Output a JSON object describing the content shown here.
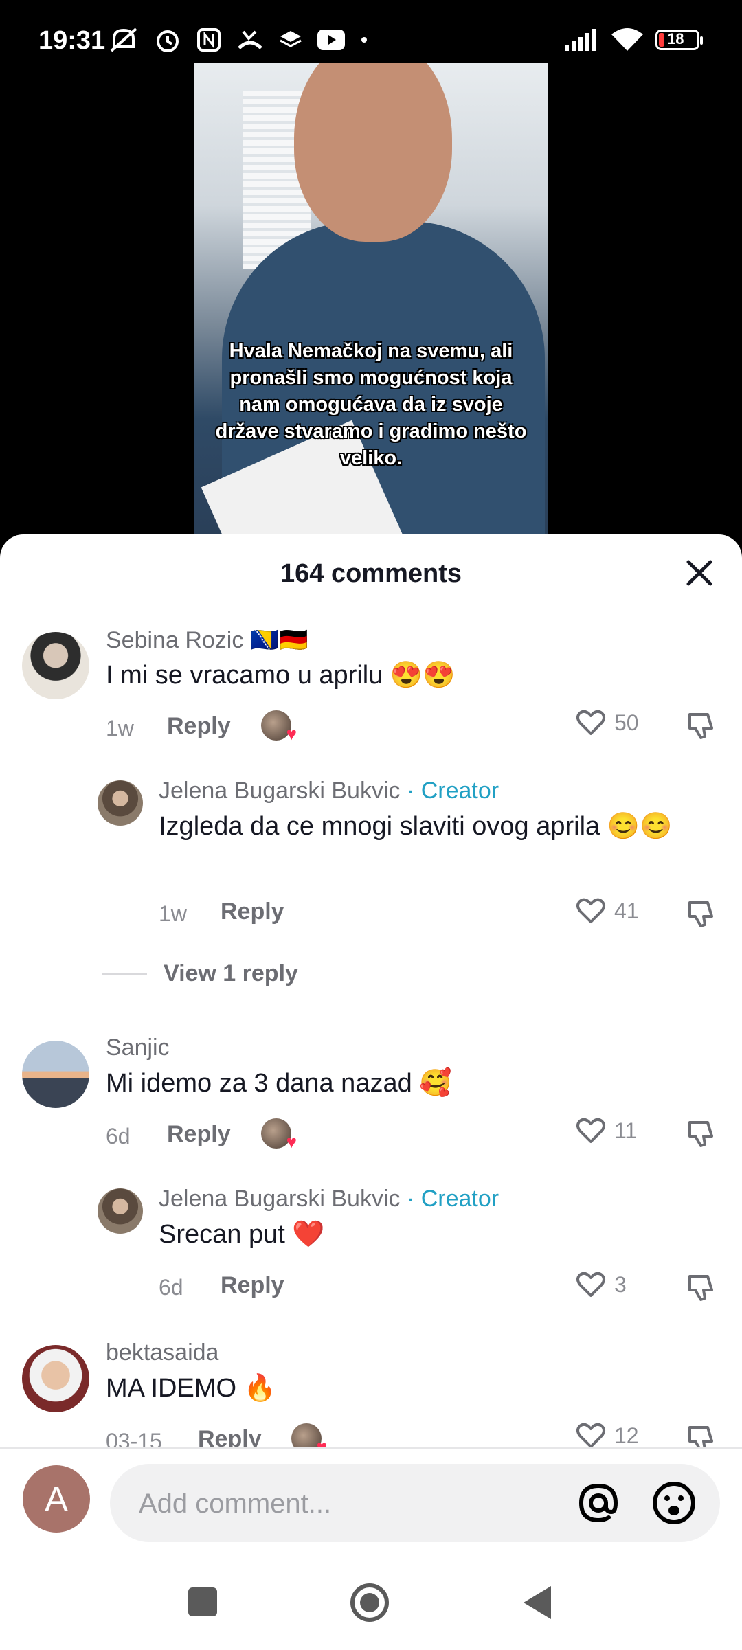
{
  "status_bar": {
    "time": "19:31",
    "battery": "18"
  },
  "video": {
    "caption": "Hvala Nemačkoj na svemu, ali pronašli smo mogućnost koja nam omogućava da iz svoje države stvaramo i gradimo nešto veliko."
  },
  "sheet": {
    "title": "164 comments"
  },
  "comments": [
    {
      "user": "Sebina Rozic 🇧🇦🇩🇪",
      "text": "I mi se vracamo u aprilu 😍😍",
      "time": "1w",
      "reply": "Reply",
      "likes": "50"
    },
    {
      "user": "Jelena Bugarski Bukvic",
      "creator": "· Creator",
      "text": "Izgleda da ce mnogi slaviti ovog aprila 😊😊",
      "time": "1w",
      "reply": "Reply",
      "likes": "41"
    },
    {
      "user": "Sanjic",
      "text": "Mi idemo za 3 dana nazad 🥰",
      "time": "6d",
      "reply": "Reply",
      "likes": "11"
    },
    {
      "user": "Jelena Bugarski Bukvic",
      "creator": "· Creator",
      "text": "Srecan put ❤️",
      "time": "6d",
      "reply": "Reply",
      "likes": "3"
    },
    {
      "user": "bektasaida",
      "text": "MA IDEMO 🔥",
      "time": "03-15",
      "reply": "Reply",
      "likes": "12"
    }
  ],
  "view_reply": "View 1 reply",
  "composer": {
    "avatar_letter": "A",
    "placeholder": "Add comment..."
  },
  "colors": {
    "creator": "#21a0c4",
    "heart_liked": "#fe2c55",
    "text": "#161823",
    "muted": "#8a8b91"
  }
}
